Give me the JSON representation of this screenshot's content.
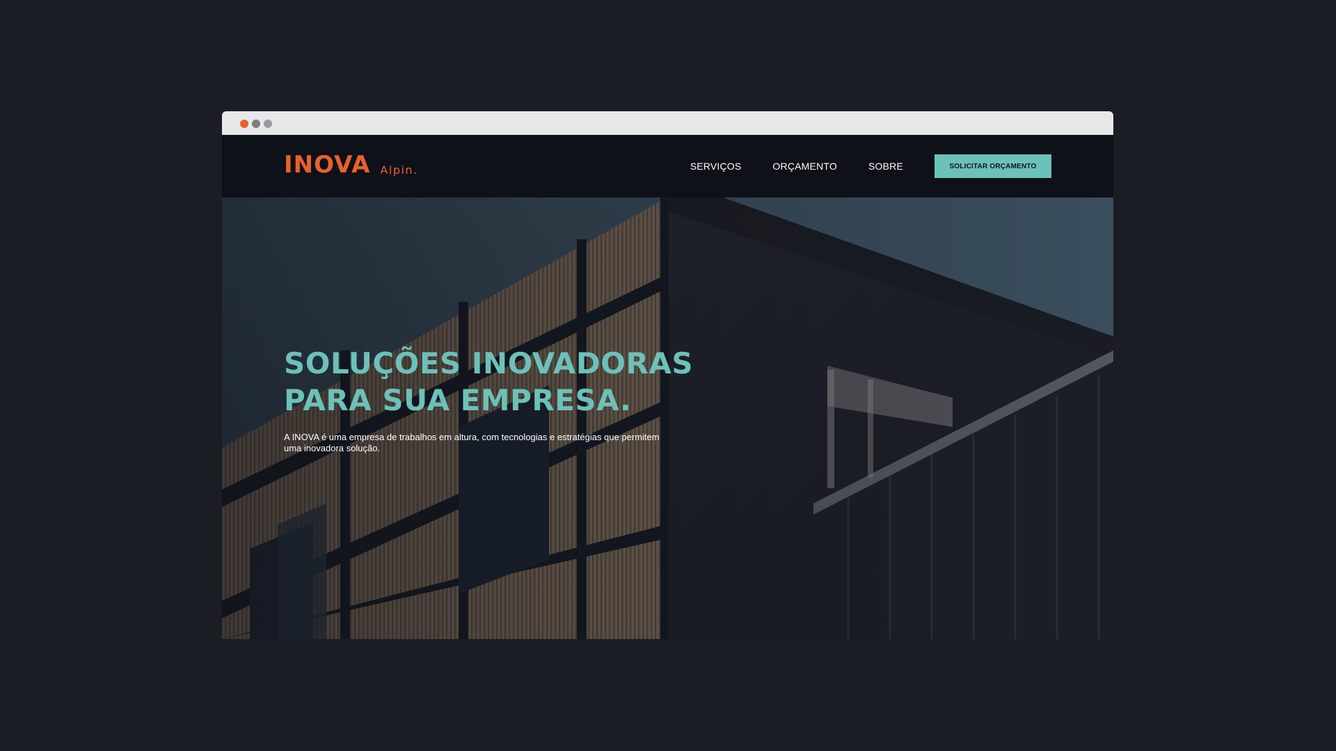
{
  "colors": {
    "accent_orange": "#e8612c",
    "accent_teal": "#6cc1b9",
    "nav_bg": "#0f1118",
    "page_bg": "#1b1d25",
    "chrome_bar": "#e8e8ea",
    "dot_gray_1": "#7d7d80",
    "dot_gray_2": "#9c9ca0"
  },
  "browser": {
    "window_controls": [
      "close-dot",
      "minimize-dot",
      "maximize-dot"
    ]
  },
  "header": {
    "logo_main": "INOVA",
    "logo_sub": "Alpin.",
    "nav": [
      {
        "label": "SERVIÇOS"
      },
      {
        "label": "ORÇAMENTO"
      },
      {
        "label": "SOBRE"
      }
    ],
    "cta_label": "SOLICITAR ORÇAMENTO"
  },
  "hero": {
    "title_line_1": "SOLUÇÕES INOVADORAS",
    "title_line_2": "PARA SUA EMPRESA.",
    "description": "A INOVA é uma empresa de trabalhos em altura, com tecnologias e estratégias que permitem uma inovadora solução."
  }
}
